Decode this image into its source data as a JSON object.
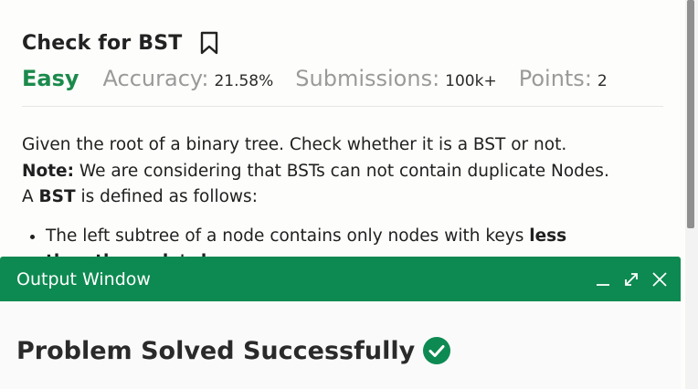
{
  "problem": {
    "title": "Check for BST",
    "difficulty": "Easy",
    "accuracy_label": "Accuracy:",
    "accuracy_value": "21.58%",
    "submissions_label": "Submissions:",
    "submissions_value": "100k+",
    "points_label": "Points:",
    "points_value": "2",
    "line1": "Given the root of a binary tree. Check whether it is a BST or not.",
    "note_label": "Note:",
    "note_text": " We are considering that BSTs can not contain duplicate Nodes.",
    "def_prefix": "A ",
    "def_bold": "BST",
    "def_suffix": " is defined as follows:",
    "bullet1_text": "The left subtree of a node contains only nodes with keys ",
    "bullet1_bold": "less",
    "bullet1_cont": "than the node's key."
  },
  "output_window": {
    "title": "Output Window",
    "result": "Problem Solved Successfully"
  },
  "icons": {
    "bookmark": "bookmark-icon",
    "minimize": "minimize-icon",
    "expand": "expand-icon",
    "close": "close-icon",
    "success": "check-circle-icon"
  },
  "colors": {
    "accent_green": "#0d8a51",
    "difficulty_green": "#1b8a4c",
    "muted_label": "#9a9a9a"
  }
}
